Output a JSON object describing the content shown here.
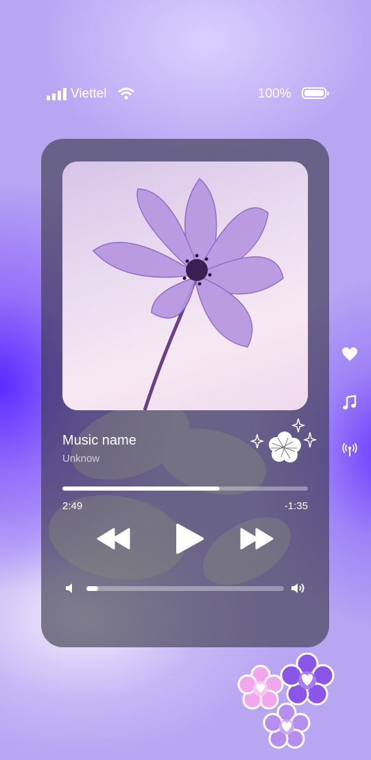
{
  "status_bar": {
    "carrier": "Viettel",
    "battery_percent": "100%",
    "signal_bars": 4,
    "icons": [
      "signal-icon",
      "wifi-icon",
      "battery-icon"
    ]
  },
  "player": {
    "song_title": "Music name",
    "artist": "Unknow",
    "elapsed": "2:49",
    "remaining": "-1:35",
    "progress_fraction": 0.64,
    "volume_fraction": 0.06,
    "controls": [
      "rewind-icon",
      "play-icon",
      "fast-forward-icon"
    ]
  },
  "side_actions": [
    "heart-icon",
    "music-note-icon",
    "broadcast-icon"
  ],
  "colors": {
    "card": "#3a3a48",
    "accent": "#7c5cf0",
    "text": "#ffffff",
    "sub_text": "#cfcfd6"
  }
}
